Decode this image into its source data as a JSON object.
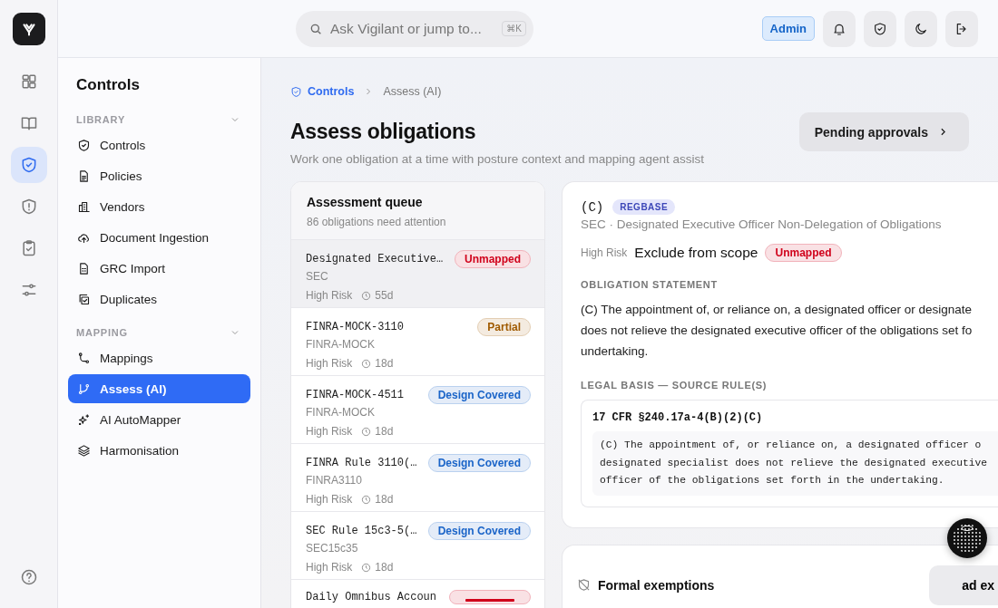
{
  "rail": {
    "items": [
      {
        "kind": "dashboard",
        "selected": false
      },
      {
        "kind": "book",
        "selected": false
      },
      {
        "kind": "shield",
        "selected": true
      },
      {
        "kind": "alert",
        "selected": false
      },
      {
        "kind": "clipboard",
        "selected": false
      },
      {
        "kind": "sliders",
        "selected": false
      }
    ],
    "bottom": [
      {
        "kind": "help",
        "selected": false
      }
    ]
  },
  "search": {
    "placeholder": "Ask Vigilant or jump to...",
    "shortcut": "⌘K"
  },
  "role_badge": "Admin",
  "header_buttons": [
    {
      "kind": "bell"
    },
    {
      "kind": "shield"
    },
    {
      "kind": "moon"
    },
    {
      "kind": "logout"
    }
  ],
  "sidebar": {
    "title": "Controls",
    "sections": [
      {
        "label": "LIBRARY",
        "expanded": true,
        "items": [
          {
            "label": "Controls",
            "kind": "shield",
            "selected": false
          },
          {
            "label": "Policies",
            "kind": "doc",
            "selected": false
          },
          {
            "label": "Vendors",
            "kind": "building",
            "selected": false
          },
          {
            "label": "Document Ingestion",
            "kind": "upload",
            "selected": false
          },
          {
            "label": "GRC Import",
            "kind": "sheet",
            "selected": false
          },
          {
            "label": "Duplicates",
            "kind": "copy",
            "selected": false
          }
        ]
      },
      {
        "label": "MAPPING",
        "expanded": true,
        "items": [
          {
            "label": "Mappings",
            "kind": "route",
            "selected": false
          },
          {
            "label": "Assess (AI)",
            "kind": "branch",
            "selected": true
          },
          {
            "label": "AI AutoMapper",
            "kind": "sparkle",
            "selected": false
          },
          {
            "label": "Harmonisation",
            "kind": "layers",
            "selected": false
          }
        ]
      }
    ]
  },
  "breadcrumb": [
    {
      "label": "Controls",
      "kind": "link"
    },
    {
      "label": "Assess (AI)",
      "kind": "current"
    }
  ],
  "page": {
    "title": "Assess obligations",
    "subtitle": "Work one obligation at a time with posture context and mapping agent assist",
    "action": "Pending approvals"
  },
  "queue": {
    "title": "Assessment queue",
    "subtitle": "86 obligations need attention",
    "items": [
      {
        "title": "Designated Executive…",
        "source": "SEC",
        "risk": "High Risk",
        "age": "55d",
        "status": {
          "label": "Unmapped",
          "color": "#d0021b"
        },
        "selected": true
      },
      {
        "title": "FINRA-MOCK-3110",
        "source": "FINRA-MOCK",
        "risk": "High Risk",
        "age": "18d",
        "status": {
          "label": "Partial",
          "color": "#a05a00"
        },
        "selected": false
      },
      {
        "title": "FINRA-MOCK-4511",
        "source": "FINRA-MOCK",
        "risk": "High Risk",
        "age": "18d",
        "status": {
          "label": "Design Covered",
          "color": "#1a64c8"
        },
        "selected": false
      },
      {
        "title": "FINRA Rule 3110(…",
        "source": "FINRA3110",
        "risk": "High Risk",
        "age": "18d",
        "status": {
          "label": "Design Covered",
          "color": "#1a64c8"
        },
        "selected": false
      },
      {
        "title": "SEC Rule 15c3-5(…",
        "source": "SEC15c35",
        "risk": "High Risk",
        "age": "18d",
        "status": {
          "label": "Design Covered",
          "color": "#1a64c8"
        },
        "selected": false
      },
      {
        "title": "Daily Omnibus Accoun",
        "status": {
          "color": "#d0021b"
        },
        "selected": false
      }
    ]
  },
  "detail": {
    "code": "(C)",
    "tag": "REGBASE",
    "subtitle": "SEC · Designated Executive Officer Non-Delegation of Obligations",
    "risk": "High Risk",
    "scope_action": "Exclude from scope",
    "status": {
      "label": "Unmapped",
      "color": "#d0021b"
    },
    "statement_heading": "OBLIGATION STATEMENT",
    "statement_lines": [
      "(C) The appointment of, or reliance on, a designated officer or designate",
      "does not relieve the designated executive officer of the obligations set fo",
      "undertaking."
    ],
    "legal_heading": "LEGAL BASIS — SOURCE RULE(S)",
    "rules": [
      {
        "citation": "17 CFR §240.17a-4(B)(2)(C)",
        "text_lines": [
          "(C) The appointment of, or reliance on, a designated officer o",
          "designated specialist does not relieve the designated executive",
          "officer of the obligations set forth in the undertaking."
        ]
      }
    ]
  },
  "exemptions": {
    "title": "Formal exemptions",
    "action": "ad ex"
  }
}
